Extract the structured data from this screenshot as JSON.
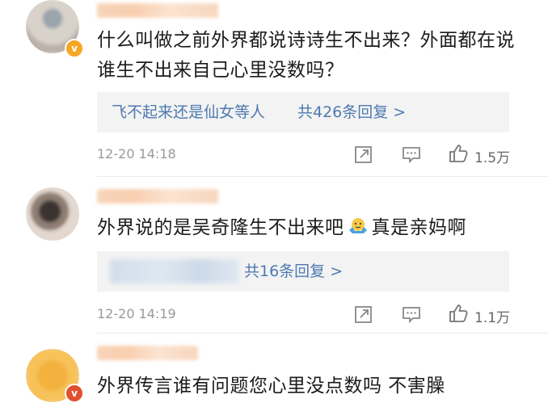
{
  "comments": [
    {
      "text": "什么叫做之前外界都说诗诗生不出来？外面都在说谁生不出来自己心里没数吗？",
      "reply_prefix": "飞不起来还是仙女等人",
      "reply_count": "共426条回复 >",
      "time": "12-20 14:18",
      "likes": "1.5万",
      "verified_badge": "v"
    },
    {
      "text_before_emoji": "外界说的是吴奇隆生不出来吧",
      "emoji": "shrug-emoji",
      "text_after_emoji": "真是亲妈啊",
      "reply_count": "共16条回复 >",
      "time": "12-20 14:19",
      "likes": "1.1万"
    },
    {
      "text": "外界传言谁有问题您心里没点数吗 不害臊",
      "verified_badge": "v"
    }
  ],
  "colors": {
    "link_blue": "#4e7ab0",
    "meta_gray": "#999999",
    "reply_bg": "#f3f3f3"
  },
  "icons": [
    "repost-icon",
    "comment-icon",
    "like-icon"
  ]
}
